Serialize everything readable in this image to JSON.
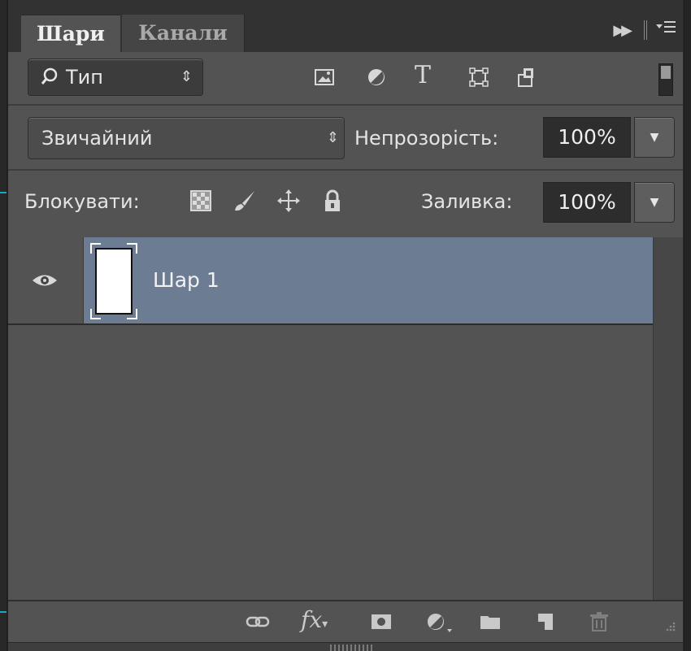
{
  "tabs": [
    {
      "label": "Шари",
      "active": true
    },
    {
      "label": "Канали",
      "active": false
    }
  ],
  "panel_controls": {
    "collapse_icon": "double-arrow-right-icon",
    "menu_icon": "panel-menu-icon"
  },
  "filter": {
    "kind_label": "Тип",
    "icons": [
      "pixel-filter-icon",
      "adjustment-filter-icon",
      "type-filter-icon",
      "shape-filter-icon",
      "smart-object-filter-icon"
    ],
    "type_glyph": "T"
  },
  "blend": {
    "mode": "Звичайний",
    "opacity_label": "Непрозорість:",
    "opacity_value": "100%"
  },
  "lock": {
    "label": "Блокувати:",
    "icons": [
      "lock-transparent-pixels-icon",
      "lock-image-pixels-icon",
      "lock-position-icon",
      "lock-all-icon"
    ],
    "fill_label": "Заливка:",
    "fill_value": "100%"
  },
  "layers": [
    {
      "name": "Шар 1",
      "visible": true,
      "selected": true
    }
  ],
  "footer_icons": [
    "link-layers-icon",
    "fx-icon",
    "add-mask-icon",
    "adjustment-layer-icon",
    "new-group-icon",
    "new-layer-icon",
    "delete-layer-icon"
  ],
  "footer_fx": "fx",
  "colors": {
    "panel_bg": "#535353",
    "selected_layer": "#6b7c93",
    "guide": "#16a8c7"
  }
}
